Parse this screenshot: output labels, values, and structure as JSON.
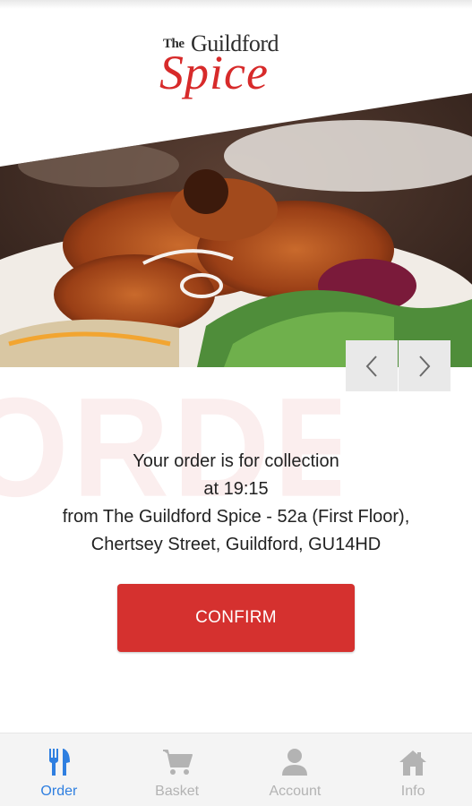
{
  "brand": {
    "logo_the": "The",
    "logo_guildford": "Guildford",
    "logo_spice": "Spice",
    "brand_red": "#d72a2a"
  },
  "hero": {
    "prev_icon": "chevron-left-icon",
    "next_icon": "chevron-right-icon"
  },
  "watermark": "ORDER",
  "order_message": {
    "line1": "Your order is for collection",
    "line2": "at 19:15",
    "line3": "from The Guildford Spice - 52a (First Floor),",
    "line4": "Chertsey Street, Guildford, GU14HD"
  },
  "confirm_button": {
    "label": "CONFIRM",
    "color": "#d5312f"
  },
  "tabbar": {
    "active_color": "#2f7fe0",
    "inactive_color": "#b3b3b3",
    "tabs": [
      {
        "label": "Order",
        "icon": "fork-knife-icon",
        "active": true
      },
      {
        "label": "Basket",
        "icon": "cart-icon",
        "active": false
      },
      {
        "label": "Account",
        "icon": "person-icon",
        "active": false
      },
      {
        "label": "Info",
        "icon": "home-icon",
        "active": false
      }
    ]
  }
}
